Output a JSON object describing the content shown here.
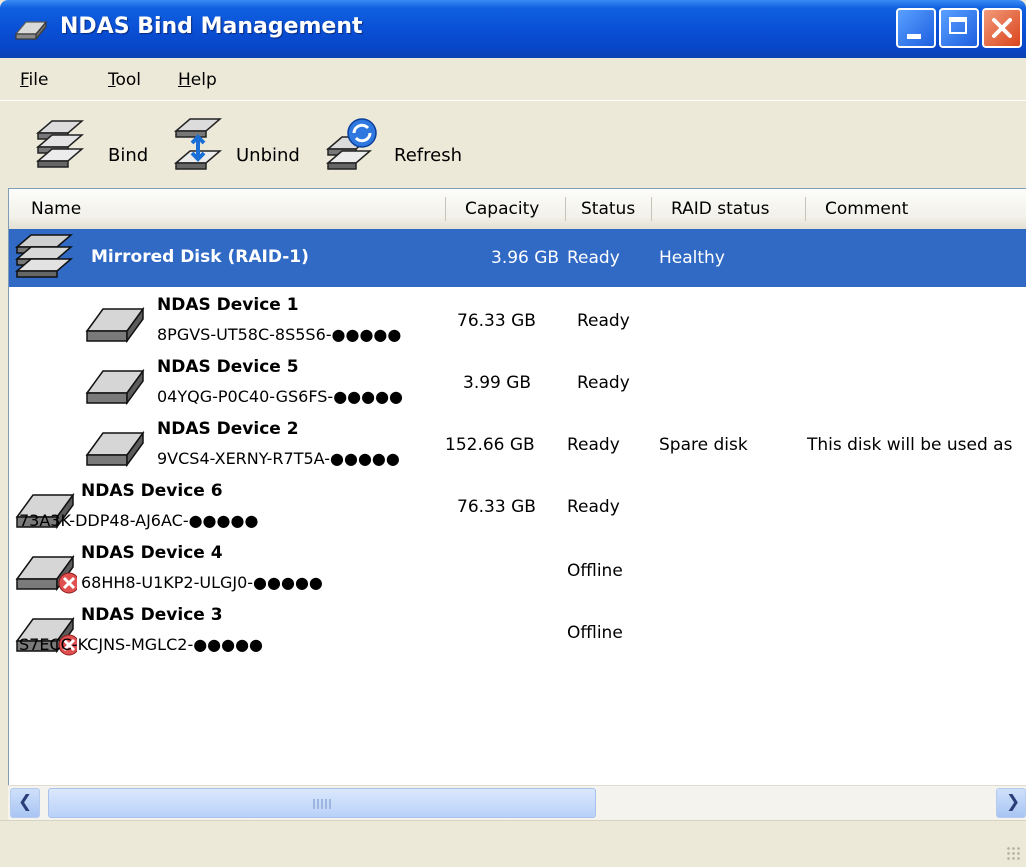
{
  "window": {
    "title": "NDAS Bind Management",
    "icon": "ndas-disk-app-icon"
  },
  "menu": [
    {
      "first": "F",
      "rest": "ile"
    },
    {
      "first": "T",
      "rest": "ool"
    },
    {
      "first": "H",
      "rest": "elp"
    }
  ],
  "toolbar": {
    "bind_label": "Bind",
    "unbind_label": "Unbind",
    "refresh_label": "Refresh"
  },
  "columns": {
    "name": "Name",
    "capacity": "Capacity",
    "status": "Status",
    "raid_status": "RAID status",
    "comment": "Comment"
  },
  "rows": [
    {
      "name": "Mirrored Disk (RAID-1)",
      "id": "",
      "capacity": "3.96 GB",
      "status": "Ready",
      "raid_status": "Healthy",
      "comment": "",
      "selected": true,
      "icon": "raid-disk-icon"
    },
    {
      "name": "NDAS Device 1",
      "id": "8PGVS-UT58C-8S5S6-●●●●●",
      "capacity": "76.33 GB",
      "status": "Ready",
      "raid_status": "",
      "comment": ""
    },
    {
      "name": "NDAS Device 5",
      "id": "04YQG-P0C40-GS6FS-●●●●●",
      "capacity": "3.99 GB",
      "status": "Ready",
      "raid_status": "",
      "comment": ""
    },
    {
      "name": "NDAS Device 2",
      "id": "9VCS4-XERNY-R7T5A-●●●●●",
      "capacity": "152.66 GB",
      "status": "Ready",
      "raid_status": "Spare disk",
      "comment": "This disk will be used as"
    },
    {
      "name": "NDAS Device 6",
      "id": "73A3K-DDP48-AJ6AC-●●●●●",
      "capacity": "76.33 GB",
      "status": "Ready",
      "raid_status": "",
      "comment": ""
    },
    {
      "name": "NDAS Device 4",
      "id": "68HH8-U1KP2-ULGJ0-●●●●●",
      "capacity": "",
      "status": "Offline",
      "raid_status": "",
      "comment": ""
    },
    {
      "name": "NDAS Device 3",
      "id": "S7ECC-KCJNS-MGLC2-●●●●●",
      "capacity": "",
      "status": "Offline",
      "raid_status": "",
      "comment": ""
    }
  ],
  "scrollbar": {
    "left_arrow": "❮",
    "right_arrow": "❯"
  },
  "colors": {
    "selection": "#316ac5",
    "titlebar": "#0a50d6"
  }
}
